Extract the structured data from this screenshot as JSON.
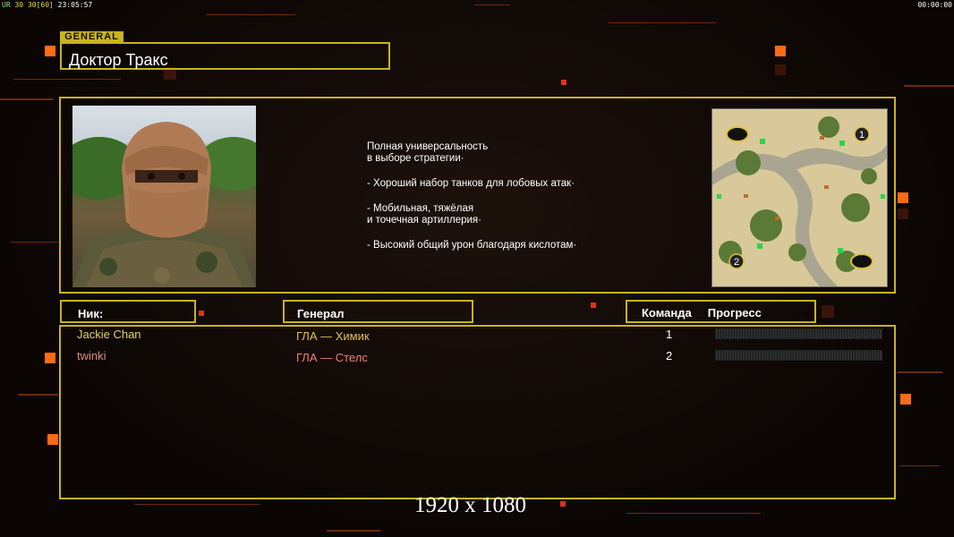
{
  "topbar": {
    "left_prefix": "UR",
    "left_a": "30",
    "left_b": "30",
    "left_c": "[60]",
    "clock": "23:05:57",
    "right_timer": "00:00:00"
  },
  "general_tag": "GENERAL",
  "general_name": "Доктор Тракс",
  "description": [
    [
      "Полная универсальность",
      "в выборе стратегии·"
    ],
    [
      "- Хороший набор танков для лобовых атак·"
    ],
    [
      "- Мобильная, тяжёлая",
      "и точечная артиллерия·"
    ],
    [
      "- Высокий общий урон благодаря кислотам·"
    ]
  ],
  "columns": {
    "nick": "Ник:",
    "general": "Генерал",
    "team": "Команда",
    "progress": "Прогресс"
  },
  "players": [
    {
      "nick": "Jackie Chan",
      "general": "ГЛА — Химик",
      "team": "1",
      "progress": 0,
      "color": "#e3d060",
      "gen_color": "#e3c050"
    },
    {
      "nick": "twinki",
      "general": "ГЛА — Стелс",
      "team": "2",
      "progress": 0,
      "color": "#e08a78",
      "gen_color": "#ef7f78"
    }
  ],
  "map_markers": [
    "1",
    "2"
  ],
  "resolution_caption": "1920 x 1080",
  "colors": {
    "frame": "#c9b31f",
    "accent": "#ff6a14",
    "background": "#0c0705"
  }
}
